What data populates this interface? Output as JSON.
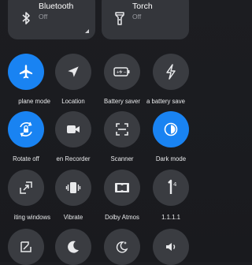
{
  "top_tiles": [
    {
      "title": "Bluetooth",
      "status": "Off",
      "icon": "bluetooth-icon"
    },
    {
      "title": "Torch",
      "status": "Off",
      "icon": "torch-icon"
    }
  ],
  "toggles": [
    {
      "label": "plane mode",
      "icon": "airplane-icon",
      "active": true
    },
    {
      "label": "Location",
      "icon": "location-icon",
      "active": false
    },
    {
      "label": "Battery saver",
      "icon": "battery-icon",
      "active": false
    },
    {
      "label": "a battery save",
      "icon": "lightning-icon",
      "active": false
    },
    {
      "label": "Rotate off",
      "icon": "rotate-lock-icon",
      "active": true
    },
    {
      "label": "en Recorder",
      "icon": "video-icon",
      "active": false
    },
    {
      "label": "Scanner",
      "icon": "scanner-icon",
      "active": false
    },
    {
      "label": "Dark mode",
      "icon": "dark-mode-icon",
      "active": true
    },
    {
      "label": "iting windows",
      "icon": "floating-window-icon",
      "active": false
    },
    {
      "label": "Vibrate",
      "icon": "vibrate-icon",
      "active": false
    },
    {
      "label": "Dolby Atmos",
      "icon": "dolby-icon",
      "active": false
    },
    {
      "label": "1.1.1.1",
      "icon": "dns-1111-icon",
      "active": false
    }
  ],
  "colors": {
    "accent": "#1983f2",
    "tile": "#3a3c41",
    "background": "#1c1d21"
  }
}
